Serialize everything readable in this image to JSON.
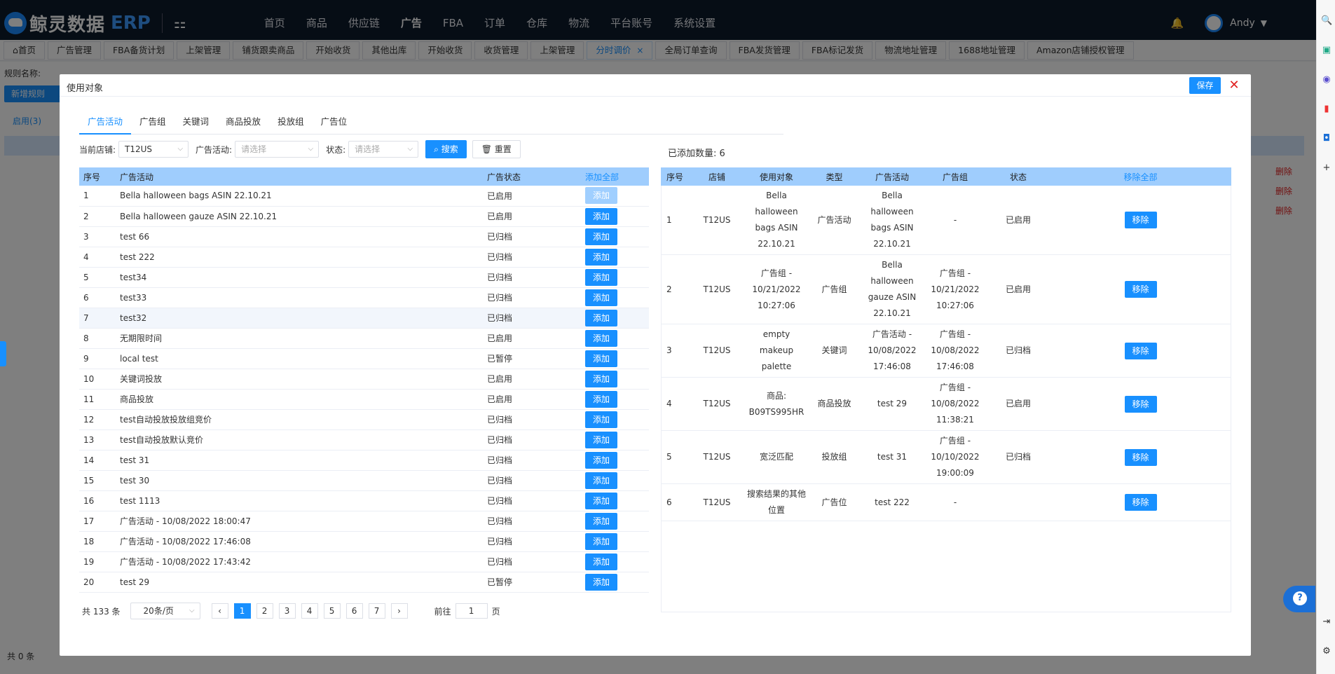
{
  "header": {
    "logo_text": "鲸灵数据",
    "logo_erp": "ERP",
    "nav": [
      "首页",
      "商品",
      "供应链",
      "广告",
      "FBA",
      "订单",
      "仓库",
      "物流",
      "平台账号",
      "系统设置"
    ],
    "user": "Andy"
  },
  "tabs": [
    "首页",
    "广告管理",
    "FBA备货计划",
    "上架管理",
    "铺货跟卖商品",
    "开始收货",
    "其他出库",
    "开始收货",
    "收货管理",
    "上架管理",
    "分时调价",
    "全局订单查询",
    "FBA发货管理",
    "FBA标记发货",
    "物流地址管理",
    "1688地址管理",
    "Amazon店铺授权管理"
  ],
  "background": {
    "rule_label": "规则名称:",
    "new_rule": "新增规则",
    "enabled_tab": "启用(3)",
    "delete": "删除",
    "total": "共 0 条"
  },
  "modal": {
    "title": "使用对象",
    "save": "保存",
    "subtabs": [
      "广告活动",
      "广告组",
      "关键词",
      "商品投放",
      "投放组",
      "广告位"
    ],
    "filters": {
      "shop_label": "当前店铺:",
      "shop_value": "T12US",
      "campaign_label": "广告活动:",
      "campaign_placeholder": "请选择",
      "status_label": "状态:",
      "status_placeholder": "请选择",
      "search": "搜索",
      "reset": "重置"
    },
    "added_count": "已添加数量: 6",
    "left_table": {
      "headers": [
        "序号",
        "广告活动",
        "广告状态",
        "添加全部"
      ],
      "add_label": "添加",
      "rows": [
        {
          "idx": "1",
          "name": "Bella halloween bags ASIN 22.10.21",
          "status": "已启用"
        },
        {
          "idx": "2",
          "name": "Bella halloween gauze ASIN 22.10.21",
          "status": "已启用"
        },
        {
          "idx": "3",
          "name": "test 66",
          "status": "已归档"
        },
        {
          "idx": "4",
          "name": "test 222",
          "status": "已归档"
        },
        {
          "idx": "5",
          "name": "test34",
          "status": "已归档"
        },
        {
          "idx": "6",
          "name": "test33",
          "status": "已归档"
        },
        {
          "idx": "7",
          "name": "test32",
          "status": "已归档"
        },
        {
          "idx": "8",
          "name": "无期限时间",
          "status": "已启用"
        },
        {
          "idx": "9",
          "name": "local test",
          "status": "已暂停"
        },
        {
          "idx": "10",
          "name": "关键词投放",
          "status": "已启用"
        },
        {
          "idx": "11",
          "name": "商品投放",
          "status": "已启用"
        },
        {
          "idx": "12",
          "name": "test自动投放投放组竞价",
          "status": "已归档"
        },
        {
          "idx": "13",
          "name": "test自动投放默认竞价",
          "status": "已归档"
        },
        {
          "idx": "14",
          "name": "test 31",
          "status": "已归档"
        },
        {
          "idx": "15",
          "name": "test 30",
          "status": "已归档"
        },
        {
          "idx": "16",
          "name": "test 1113",
          "status": "已归档"
        },
        {
          "idx": "17",
          "name": "广告活动 - 10/08/2022 18:00:47",
          "status": "已归档"
        },
        {
          "idx": "18",
          "name": "广告活动 - 10/08/2022 17:46:08",
          "status": "已归档"
        },
        {
          "idx": "19",
          "name": "广告活动 - 10/08/2022 17:43:42",
          "status": "已归档"
        },
        {
          "idx": "20",
          "name": "test 29",
          "status": "已暂停"
        }
      ]
    },
    "right_table": {
      "headers": [
        "序号",
        "店铺",
        "使用对象",
        "类型",
        "广告活动",
        "广告组",
        "状态",
        "移除全部"
      ],
      "remove_label": "移除",
      "rows": [
        {
          "idx": "1",
          "shop": "T12US",
          "target": "Bella halloween bags ASIN 22.10.21",
          "type": "广告活动",
          "campaign": "Bella halloween bags ASIN 22.10.21",
          "group": "-",
          "status": "已启用"
        },
        {
          "idx": "2",
          "shop": "T12US",
          "target": "广告组 - 10/21/2022 10:27:06",
          "type": "广告组",
          "campaign": "Bella halloween gauze ASIN 22.10.21",
          "group": "广告组 - 10/21/2022 10:27:06",
          "status": "已启用"
        },
        {
          "idx": "3",
          "shop": "T12US",
          "target": "empty makeup palette",
          "type": "关键词",
          "campaign": "广告活动 - 10/08/2022 17:46:08",
          "group": "广告组 - 10/08/2022 17:46:08",
          "status": "已归档"
        },
        {
          "idx": "4",
          "shop": "T12US",
          "target": "商品: B09TS995HR",
          "type": "商品投放",
          "campaign": "test 29",
          "group": "广告组 - 10/08/2022 11:38:21",
          "status": "已启用"
        },
        {
          "idx": "5",
          "shop": "T12US",
          "target": "宽泛匹配",
          "type": "投放组",
          "campaign": "test 31",
          "group": "广告组 - 10/10/2022 19:00:09",
          "status": "已归档"
        },
        {
          "idx": "6",
          "shop": "T12US",
          "target": "搜索结果的其他位置",
          "type": "广告位",
          "campaign": "test 222",
          "group": "-",
          "status": ""
        }
      ]
    },
    "pager": {
      "total": "共 133 条",
      "page_size": "20条/页",
      "pages": [
        "1",
        "2",
        "3",
        "4",
        "5",
        "6",
        "7"
      ],
      "current": "1",
      "goto_label": "前往",
      "goto_value": "1",
      "page_suffix": "页"
    }
  }
}
